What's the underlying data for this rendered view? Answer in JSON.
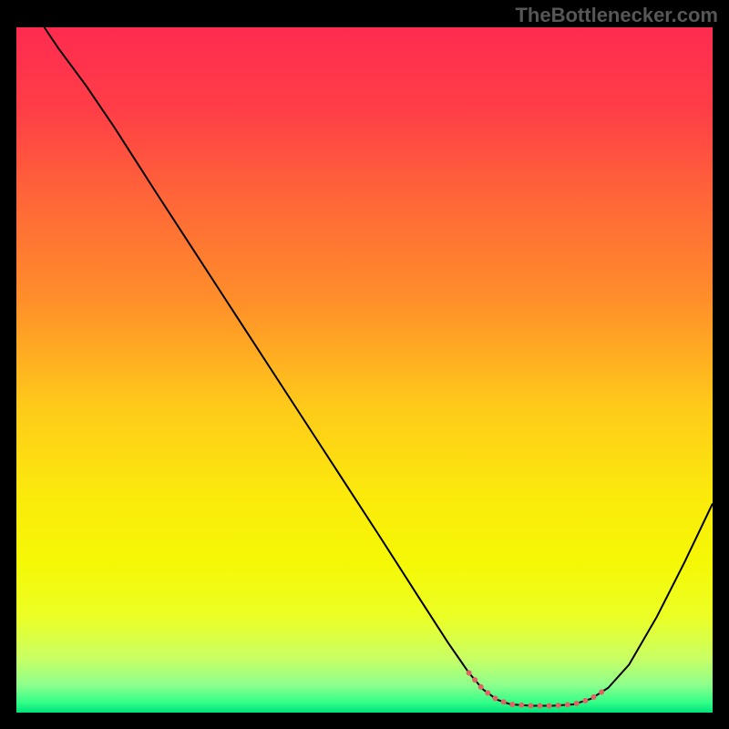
{
  "watermark": "TheBottlenecker.com",
  "chart_data": {
    "type": "line",
    "title": "",
    "xlabel": "",
    "ylabel": "",
    "xlim": [
      0,
      100
    ],
    "ylim": [
      0,
      100
    ],
    "background_gradient": {
      "type": "vertical",
      "stops": [
        {
          "pos": 0.0,
          "color": "#ff2b50"
        },
        {
          "pos": 0.12,
          "color": "#ff3e47"
        },
        {
          "pos": 0.25,
          "color": "#ff6638"
        },
        {
          "pos": 0.4,
          "color": "#ff8f2a"
        },
        {
          "pos": 0.55,
          "color": "#ffc91a"
        },
        {
          "pos": 0.68,
          "color": "#fbe90c"
        },
        {
          "pos": 0.78,
          "color": "#f5f805"
        },
        {
          "pos": 0.86,
          "color": "#ecff25"
        },
        {
          "pos": 0.92,
          "color": "#c9ff63"
        },
        {
          "pos": 0.96,
          "color": "#8dff8d"
        },
        {
          "pos": 0.985,
          "color": "#33ff88"
        },
        {
          "pos": 1.0,
          "color": "#00e27b"
        }
      ]
    },
    "series": [
      {
        "name": "curve",
        "stroke": "#000000",
        "stroke_width": 2,
        "fill": "none",
        "points": [
          {
            "x": 4.0,
            "y": 100.0
          },
          {
            "x": 6.0,
            "y": 97.0
          },
          {
            "x": 10.0,
            "y": 91.5
          },
          {
            "x": 14.0,
            "y": 85.5
          },
          {
            "x": 20.0,
            "y": 76.0
          },
          {
            "x": 28.0,
            "y": 63.5
          },
          {
            "x": 36.0,
            "y": 51.0
          },
          {
            "x": 44.0,
            "y": 38.5
          },
          {
            "x": 52.0,
            "y": 26.0
          },
          {
            "x": 58.0,
            "y": 16.5
          },
          {
            "x": 62.0,
            "y": 10.2
          },
          {
            "x": 65.0,
            "y": 5.8
          },
          {
            "x": 67.0,
            "y": 3.4
          },
          {
            "x": 69.0,
            "y": 1.9
          },
          {
            "x": 71.0,
            "y": 1.2
          },
          {
            "x": 74.0,
            "y": 1.0
          },
          {
            "x": 77.0,
            "y": 1.0
          },
          {
            "x": 80.0,
            "y": 1.2
          },
          {
            "x": 82.5,
            "y": 2.0
          },
          {
            "x": 85.0,
            "y": 3.6
          },
          {
            "x": 88.0,
            "y": 7.0
          },
          {
            "x": 92.0,
            "y": 14.0
          },
          {
            "x": 96.0,
            "y": 22.0
          },
          {
            "x": 100.0,
            "y": 30.5
          }
        ]
      },
      {
        "name": "optimal-zone",
        "stroke": "#e06666",
        "stroke_width": 6,
        "fill": "none",
        "linecap": "round",
        "dasharray": "0.1 10",
        "points": [
          {
            "x": 65.0,
            "y": 5.8
          },
          {
            "x": 67.0,
            "y": 3.4
          },
          {
            "x": 69.0,
            "y": 1.9
          },
          {
            "x": 71.0,
            "y": 1.2
          },
          {
            "x": 74.0,
            "y": 1.0
          },
          {
            "x": 77.0,
            "y": 1.0
          },
          {
            "x": 80.0,
            "y": 1.2
          },
          {
            "x": 82.5,
            "y": 2.0
          },
          {
            "x": 85.0,
            "y": 3.6
          }
        ]
      }
    ]
  }
}
